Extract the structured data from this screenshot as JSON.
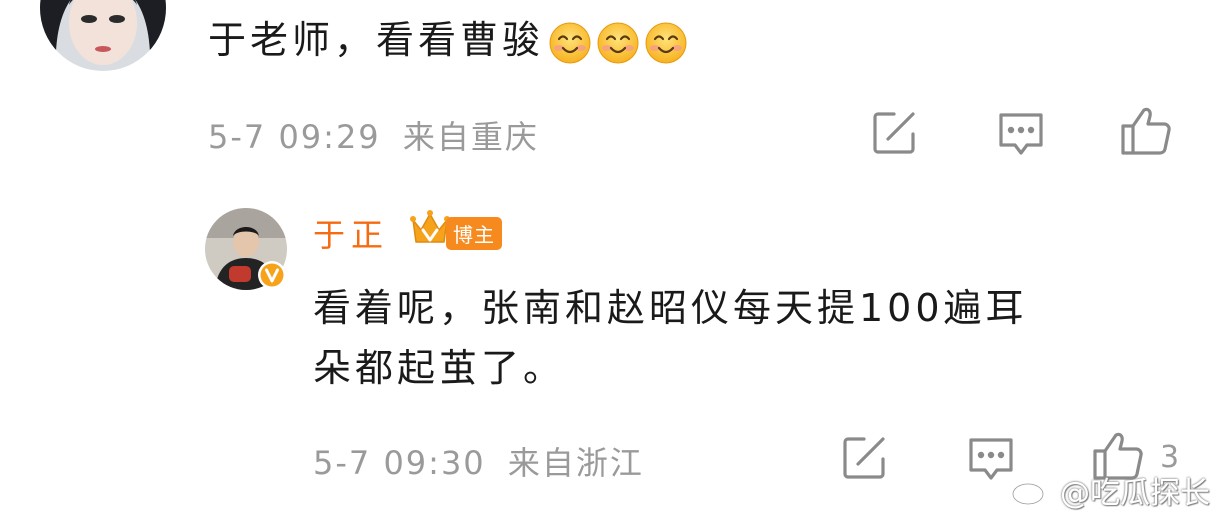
{
  "comment1": {
    "text": "于老师，看看曹骏",
    "emoji_count": 3,
    "emoji_icon": "smiling-face-emoji",
    "timestamp": "5-7 09:29",
    "location": "来自重庆",
    "actions": [
      "share-icon",
      "comment-icon",
      "like-icon"
    ]
  },
  "reply": {
    "author": "于正",
    "badge": "博主",
    "badge_icon": "crown-icon",
    "verified_icon": "verified-v-icon",
    "text_line1": "看着呢，张南和赵昭仪每天提100遍耳",
    "text_line2": "朵都起茧了。",
    "timestamp": "5-7 09:30",
    "location": "来自浙江",
    "like_count": "3",
    "actions": [
      "share-icon",
      "comment-icon",
      "like-icon"
    ]
  },
  "watermark": {
    "text": "@吃瓜探长",
    "icon": "weibo-logo-icon"
  },
  "colors": {
    "author": "#f56b12",
    "badge_bg": "#f78a1e",
    "meta": "#9a9a9a",
    "text": "#1a1a1a",
    "icon": "#8a8a8a"
  }
}
